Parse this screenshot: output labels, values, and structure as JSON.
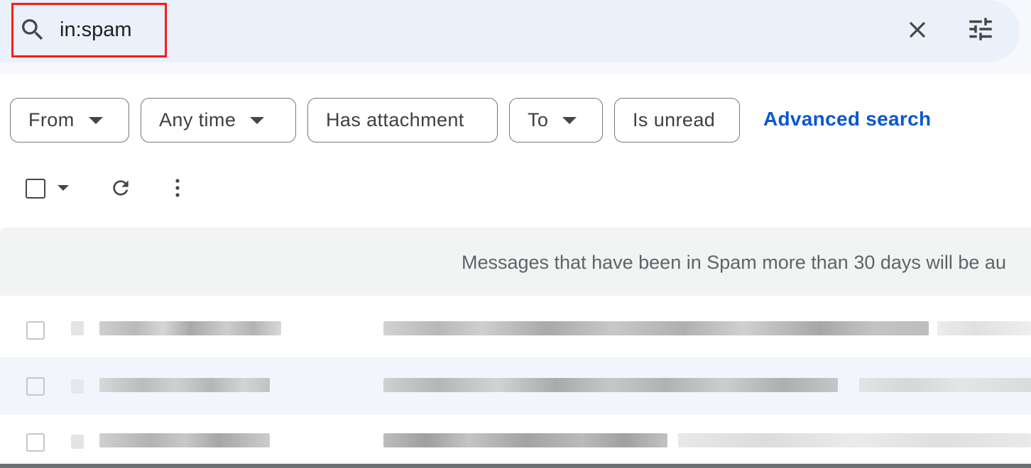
{
  "search": {
    "query": "in:spam",
    "clear_label": "Clear search",
    "options_label": "Show search options"
  },
  "filters": {
    "from": "From",
    "any_time": "Any time",
    "has_attachment": "Has attachment",
    "to": "To",
    "is_unread": "Is unread",
    "advanced_search": "Advanced search"
  },
  "spam_notice": "Messages that have been in Spam more than 30 days will be au",
  "colors": {
    "search_bg": "#eaf1fb",
    "highlight": "#ff1a1a",
    "link": "#0b57d0",
    "chip_border": "#747775"
  },
  "icons": [
    "search-icon",
    "close-icon",
    "tune-icon",
    "chevron-down-icon",
    "refresh-icon",
    "more-vert-icon"
  ]
}
